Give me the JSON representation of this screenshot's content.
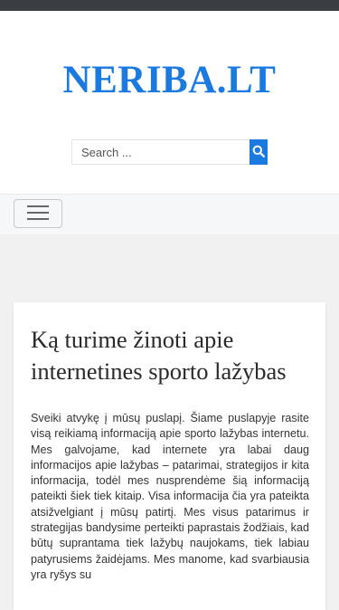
{
  "site": {
    "title": "NERIBA.LT",
    "accent_color": "#1a7ae0"
  },
  "search": {
    "placeholder": "Search ...",
    "button_icon": "search-icon"
  },
  "nav": {
    "toggle_icon": "hamburger-menu-icon"
  },
  "article": {
    "title": "Ką turime žinoti apie internetines sporto lažybas",
    "body": "Sveiki atvykę į mūsų puslapį. Šiame puslapyje rasite visą reikiamą informaciją apie sporto lažybas internetu. Mes galvojame, kad internete yra labai daug informacijos apie lažybas – patarimai, strategijos ir kita informacija, todėl mes nusprendėme šią informaciją pateikti šiek tiek kitaip. Visa informacija čia yra pateikta atsižvelgiant į mūsų patirtį. Mes visus patarimus ir strategijas bandysime perteikti paprastais žodžiais, kad būtų suprantama tiek lažybų naujokams, tiek labiau patyrusiems žaidėjams. Mes manome, kad svarbiausia yra ryšys su"
  }
}
